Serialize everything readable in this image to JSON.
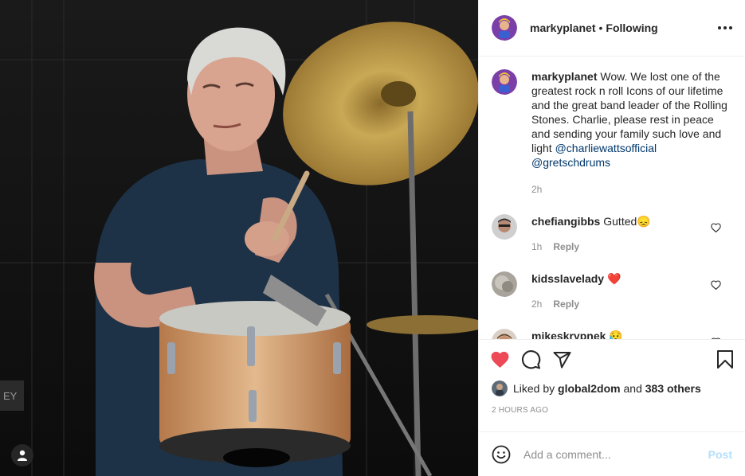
{
  "post": {
    "author": "markyplanet",
    "separator": "•",
    "follow_state": "Following",
    "caption": {
      "username": "markyplanet",
      "text": "Wow. We lost one of the greatest rock n roll Icons of our lifetime and the great band leader of the Rolling Stones. Charlie, please rest in peace and sending your family such love and light",
      "mention_1": "@charliewattsofficial",
      "mention_2": "@gretschdrums",
      "time": "2h"
    },
    "comments": [
      {
        "username": "chefiangibbs",
        "text": "Gutted",
        "emoji": "😞",
        "time": "1h",
        "reply": "Reply"
      },
      {
        "username": "kidsslavelady",
        "text": "",
        "emoji": "❤️",
        "time": "2h",
        "reply": "Reply"
      },
      {
        "username": "mikeskrypnek",
        "text": "",
        "emoji": "😥",
        "time": "",
        "reply": ""
      }
    ],
    "likes": {
      "prefix": "Liked by",
      "user": "global2dom",
      "conjunction": "and",
      "others": "383 others"
    },
    "timestamp": "2 HOURS AGO",
    "add_comment": {
      "placeholder": "Add a comment...",
      "post_label": "Post"
    },
    "icons": {
      "like": "heart-filled-icon",
      "comment": "comment-bubble-icon",
      "share": "paper-plane-icon",
      "save": "bookmark-icon",
      "more": "more-options-icon",
      "emoji": "smiley-icon",
      "tag": "user-tag-icon"
    },
    "colors": {
      "like_red": "#ed4956",
      "link_blue": "#00376b",
      "post_button_disabled": "#b2dffc",
      "muted_text": "#8e8e8e"
    }
  }
}
